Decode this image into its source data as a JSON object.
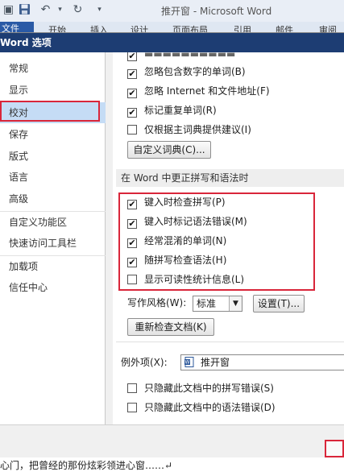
{
  "word": {
    "window_title": "推开窗 - Microsoft Word",
    "file_tab": "文件",
    "ribbon_tabs": [
      "开始",
      "插入",
      "设计",
      "页面布局",
      "引用",
      "邮件",
      "审阅"
    ]
  },
  "dialog": {
    "title": "Word 选项"
  },
  "nav": {
    "items": [
      {
        "label": "常规",
        "selected": false
      },
      {
        "label": "显示",
        "selected": false
      },
      {
        "label": "校对",
        "selected": true
      },
      {
        "label": "保存",
        "selected": false
      },
      {
        "label": "版式",
        "selected": false
      },
      {
        "label": "语言",
        "selected": false
      },
      {
        "label": "高级",
        "selected": false
      },
      {
        "label": "自定义功能区",
        "selected": false
      },
      {
        "label": "快速访问工具栏",
        "selected": false
      },
      {
        "label": "加载项",
        "selected": false
      },
      {
        "label": "信任中心",
        "selected": false
      }
    ]
  },
  "autocorrect": {
    "options": [
      {
        "label": "忽略包含数字的单词(B)",
        "checked": true
      },
      {
        "label": "忽略 Internet 和文件地址(F)",
        "checked": true
      },
      {
        "label": "标记重复单词(R)",
        "checked": true
      },
      {
        "label": "仅根据主词典提供建议(I)",
        "checked": false
      }
    ],
    "custom_dict_button": "自定义词典(C)..."
  },
  "grammar": {
    "section_title": "在 Word 中更正拼写和语法时",
    "options": [
      {
        "label": "键入时检查拼写(P)",
        "checked": true
      },
      {
        "label": "键入时标记语法错误(M)",
        "checked": true
      },
      {
        "label": "经常混淆的单词(N)",
        "checked": true
      },
      {
        "label": "随拼写检查语法(H)",
        "checked": true
      },
      {
        "label": "显示可读性统计信息(L)",
        "checked": false
      }
    ],
    "writing_style_label": "写作风格(W):",
    "writing_style_value": "标准",
    "settings_button": "设置(T)...",
    "recheck_button": "重新检查文档(K)"
  },
  "exceptions": {
    "label": "例外项(X):",
    "document": "推开窗",
    "options": [
      {
        "label": "只隐藏此文档中的拼写错误(S)",
        "checked": false
      },
      {
        "label": "只隐藏此文档中的语法错误(D)",
        "checked": false
      }
    ]
  },
  "document_text": "心门，把曾经的那份炫彩领进心窗……↵",
  "icons": {
    "save": "save-icon",
    "undo": "undo-icon",
    "redo": "redo-icon",
    "checkmark": "✔"
  }
}
